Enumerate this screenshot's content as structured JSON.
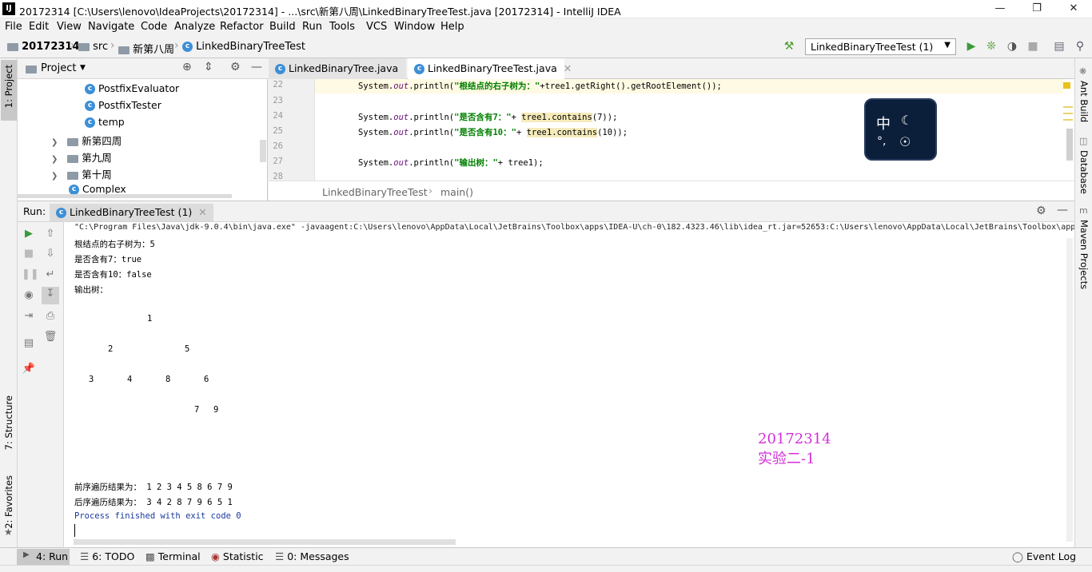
{
  "window": {
    "app_icon": "IJ",
    "title": "20172314 [C:\\Users\\lenovo\\IdeaProjects\\20172314] - ...\\src\\新第八周\\LinkedBinaryTreeTest.java [20172314] - IntelliJ IDEA",
    "minimize_icon": "minimize-icon",
    "restore_icon": "restore-icon",
    "close_icon": "close-icon"
  },
  "menu": [
    "File",
    "Edit",
    "View",
    "Navigate",
    "Code",
    "Analyze",
    "Refactor",
    "Build",
    "Run",
    "Tools",
    "VCS",
    "Window",
    "Help"
  ],
  "breadcrumb": {
    "project": "20172314",
    "src": "src",
    "folder": "新第八周",
    "file": "LinkedBinaryTreeTest"
  },
  "toolbar": {
    "run_config": "LinkedBinaryTreeTest (1)"
  },
  "left_stripe": {
    "project": "1: Project",
    "structure": "7: Structure",
    "favorites": "2: Favorites"
  },
  "right_stripe": {
    "ant": "Ant Build",
    "database": "Database",
    "maven": "Maven Projects"
  },
  "project_panel": {
    "title": "Project",
    "items": [
      {
        "label": "PostfixEvaluator",
        "type": "class"
      },
      {
        "label": "PostfixTester",
        "type": "class"
      },
      {
        "label": "temp",
        "type": "class"
      },
      {
        "label": "新第四周",
        "type": "folder"
      },
      {
        "label": "第九周",
        "type": "folder"
      },
      {
        "label": "第十周",
        "type": "folder"
      },
      {
        "label": "Complex",
        "type": "class"
      }
    ]
  },
  "editor": {
    "tabs": [
      {
        "label": "LinkedBinaryTree.java",
        "active": false
      },
      {
        "label": "LinkedBinaryTreeTest.java",
        "active": true
      }
    ],
    "lines": [
      {
        "num": "22",
        "pre": "System.",
        "out": "out",
        "mid": ".println(",
        "str": "\"根结点的右子树为：\"",
        "post": "+tree1.getRight().getRootElement());"
      },
      {
        "num": "23"
      },
      {
        "num": "24",
        "pre": "System.",
        "out": "out",
        "mid": ".println(",
        "str": "\"是否含有7：\"",
        "post": "+ ",
        "var": "tree1.contains",
        "tail": "(7));"
      },
      {
        "num": "25",
        "pre": "System.",
        "out": "out",
        "mid": ".println(",
        "str": "\"是否含有10：\"",
        "post": "+ ",
        "var": "tree1.contains",
        "tail": "(10));"
      },
      {
        "num": "26"
      },
      {
        "num": "27",
        "pre": "System.",
        "out": "out",
        "mid": ".println(",
        "str": "\"输出树：\"",
        "post": "+ tree1);"
      },
      {
        "num": "28"
      }
    ],
    "crumb_class": "LinkedBinaryTreeTest",
    "crumb_method": "main()"
  },
  "ime_widget": {
    "char": "中",
    "moon_icon": "moon-icon",
    "punct": "°,",
    "shirt_icon": "shirt-icon"
  },
  "run": {
    "label": "Run:",
    "tab": "LinkedBinaryTreeTest (1)",
    "console": {
      "command": "\"C:\\Program Files\\Java\\jdk-9.0.4\\bin\\java.exe\" -javaagent:C:\\Users\\lenovo\\AppData\\Local\\JetBrains\\Toolbox\\apps\\IDEA-U\\ch-0\\182.4323.46\\lib\\idea_rt.jar=52653:C:\\Users\\lenovo\\AppData\\Local\\JetBrains\\Toolbox\\apps",
      "right_subtree": "根结点的右子树为：5",
      "contains7": "是否含有7：true",
      "contains10": "是否含有10：false",
      "tree_label": "输出树：",
      "tree_nodes": [
        "1",
        "2",
        "5",
        "3",
        "4",
        "8",
        "6",
        "7",
        "9"
      ],
      "preorder": "前序遍历结果为： 1 2 3 4 5 8 6 7 9",
      "postorder": "后序遍历结果为： 3 4 2 8 7 9 6 5 1",
      "exit": "Process finished with exit code 0"
    }
  },
  "watermark": {
    "line1": "20172314",
    "line2": "实验二-1"
  },
  "bottom_tabs": {
    "run": "4: Run",
    "todo": "6: TODO",
    "terminal": "Terminal",
    "statistic": "Statistic",
    "messages": "0: Messages",
    "event_log": "Event Log"
  }
}
